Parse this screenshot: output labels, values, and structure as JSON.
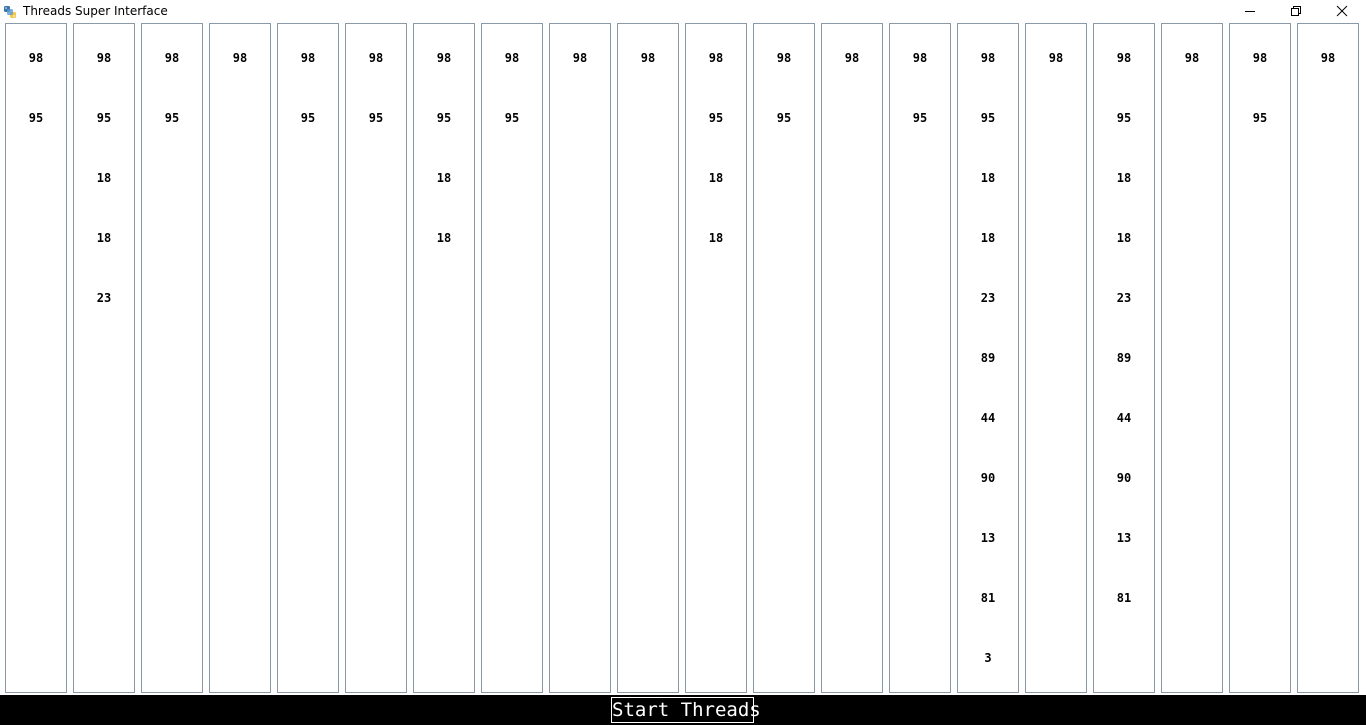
{
  "window": {
    "title": "Threads Super Interface",
    "icon": "python-app-icon",
    "controls": [
      "minimize-icon",
      "restore-icon",
      "close-icon"
    ]
  },
  "columns": [
    [
      "98",
      "95"
    ],
    [
      "98",
      "95",
      "18",
      "18",
      "23"
    ],
    [
      "98",
      "95"
    ],
    [
      "98"
    ],
    [
      "98",
      "95"
    ],
    [
      "98",
      "95"
    ],
    [
      "98",
      "95",
      "18",
      "18"
    ],
    [
      "98",
      "95"
    ],
    [
      "98"
    ],
    [
      "98"
    ],
    [
      "98",
      "95",
      "18",
      "18"
    ],
    [
      "98",
      "95"
    ],
    [
      "98"
    ],
    [
      "98",
      "95"
    ],
    [
      "98",
      "95",
      "18",
      "18",
      "23",
      "89",
      "44",
      "90",
      "13",
      "81",
      "3"
    ],
    [
      "98"
    ],
    [
      "98",
      "95",
      "18",
      "18",
      "23",
      "89",
      "44",
      "90",
      "13",
      "81"
    ],
    [
      "98"
    ],
    [
      "98",
      "95"
    ],
    [
      "98"
    ]
  ],
  "controls": {
    "start_label": "Start Threads"
  },
  "colors": {
    "column_border": "#8a9aa9",
    "bottom_bar": "#000000",
    "button_text": "#ffffff"
  }
}
